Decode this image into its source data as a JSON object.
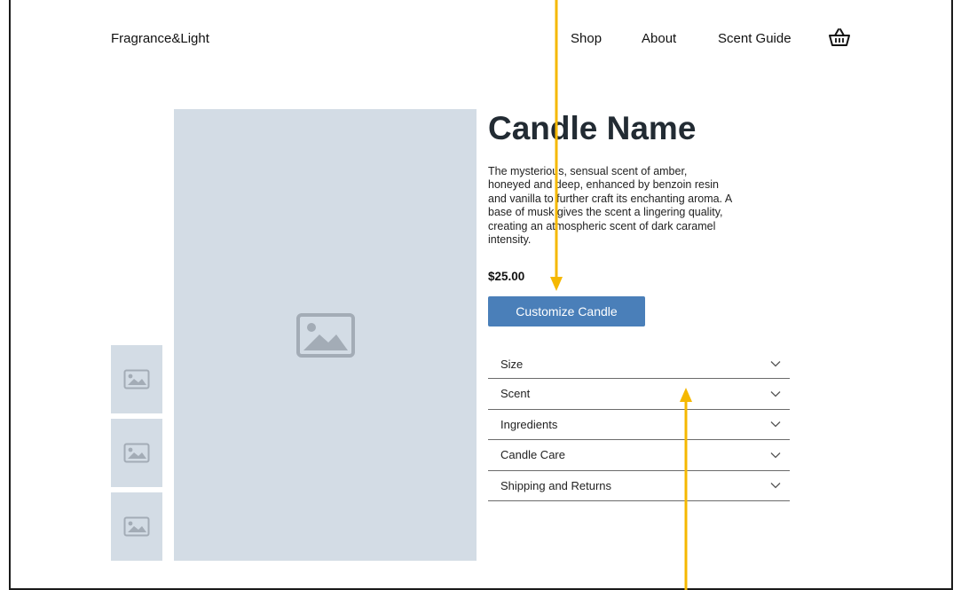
{
  "header": {
    "logo": "Fragrance&Light",
    "nav": [
      "Shop",
      "About",
      "Scent Guide"
    ],
    "cart_icon": "basket-icon"
  },
  "product": {
    "name": "Candle Name",
    "description": "The mysterious, sensual scent of amber, honeyed and deep, enhanced by benzoin resin and vanilla to further craft its enchanting aroma. A base of musk gives the scent a lingering quality, creating an atmospheric scent of dark caramel intensity.",
    "price": "$25.00",
    "cta_label": "Customize Candle"
  },
  "accordion": [
    {
      "label": "Size"
    },
    {
      "label": "Scent"
    },
    {
      "label": "Ingredients"
    },
    {
      "label": "Candle Care"
    },
    {
      "label": "Shipping and Returns"
    }
  ],
  "colors": {
    "accent": "#4a7fb9",
    "placeholder": "#d3dce5",
    "annotation_arrow": "#f5b800"
  }
}
